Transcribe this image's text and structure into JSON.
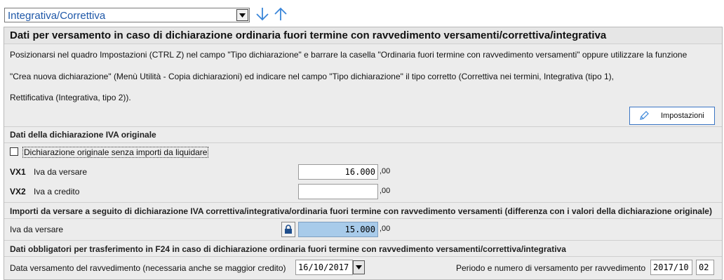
{
  "toolbar": {
    "select_value": "Integrativa/Correttiva",
    "arrow_down_icon": "arrow-down-icon",
    "arrow_up_icon": "arrow-up-icon",
    "accent": "#3a86d9"
  },
  "panel": {
    "title": "Dati per versamento in caso di dichiarazione ordinaria fuori termine con ravvedimento versamenti/correttiva/integrativa",
    "info_lines": [
      "Posizionarsi nel quadro Impostazioni (CTRL Z) nel campo \"Tipo dichiarazione\" e barrare la casella \"Ordinaria fuori termine con ravvedimento versamenti\" oppure utilizzare la funzione",
      "\"Crea nuova dichiarazione\" (Menù Utilità - Copia dichiarazioni) ed indicare nel campo \"Tipo dichiarazione\" il tipo corretto (Correttiva nei termini, Integrativa (tipo 1),",
      "Rettificativa (Integrativa, tipo 2))."
    ],
    "impostazioni_button": "Impostazioni",
    "impostazioni_icon": "pencil-icon"
  },
  "section_original": {
    "header": "Dati della dichiarazione IVA originale",
    "checkbox_label": "Dichiarazione originale senza importi da liquidare",
    "checkbox_checked": false,
    "vx1": {
      "code": "VX1",
      "label": "Iva da versare",
      "value": "16.000",
      "decimals": ",00"
    },
    "vx2": {
      "code": "VX2",
      "label": "Iva a credito",
      "value": "",
      "decimals": ",00"
    }
  },
  "section_diff": {
    "header": "Importi da versare a seguito di dichiarazione IVA correttiva/integrativa/ordinaria fuori termine con ravvedimento versamenti (differenza con i valori della dichiarazione originale)",
    "iva_label": "Iva da versare",
    "iva_value": "15.000",
    "iva_decimals": ",00",
    "lock_icon": "lock-icon",
    "field_color": "#a8cbea"
  },
  "section_f24": {
    "header": "Dati obbligatori per trasferimento in F24 in caso di dichiarazione ordinaria fuori termine con ravvedimento versamenti/correttiva/integrativa",
    "date_label": "Data versamento del ravvedimento (necessaria anche se maggior credito)",
    "date_value": "16/10/2017",
    "period_label": "Periodo e numero di versamento per ravvedimento",
    "period_value": "2017/10",
    "number_value": "02"
  }
}
